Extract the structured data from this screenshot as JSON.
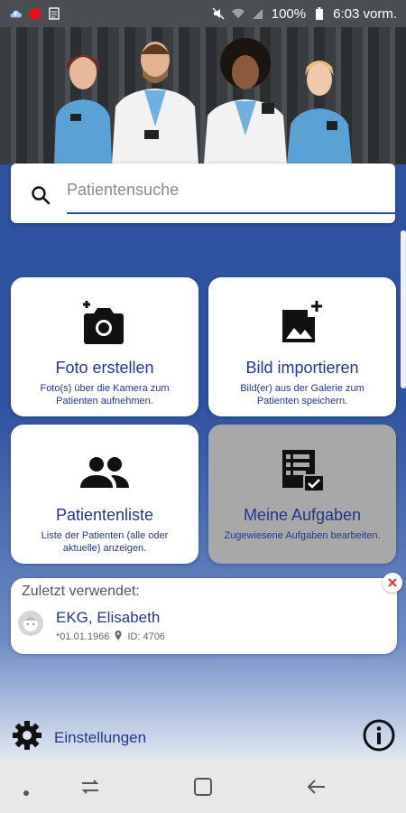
{
  "status_bar": {
    "battery": "100%",
    "time": "6:03 vorm.",
    "icons": [
      "cloud-icon",
      "record-dot-icon",
      "document-icon",
      "mute-icon",
      "wifi-icon",
      "signal-icon",
      "battery-icon"
    ]
  },
  "hero": {
    "image": "doctors-group-photo"
  },
  "search": {
    "placeholder": "Patientensuche",
    "value": ""
  },
  "tiles": [
    {
      "title": "Foto erstellen",
      "desc": "Foto(s) über die Kamera zum Patienten aufnehmen.",
      "icon": "add-camera-icon",
      "enabled": true
    },
    {
      "title": "Bild importieren",
      "desc": "Bild(er) aus der Galerie zum Patienten speichern.",
      "icon": "add-image-icon",
      "enabled": true
    },
    {
      "title": "Patientenliste",
      "desc": "Liste der Patienten (alle oder aktuelle) anzeigen.",
      "icon": "people-icon",
      "enabled": true
    },
    {
      "title": "Meine Aufgaben",
      "desc": "Zugewiesene Aufgaben bearbeiten.",
      "icon": "task-list-icon",
      "enabled": false
    }
  ],
  "recent": {
    "label": "Zuletzt verwendet:",
    "patient": {
      "name": "EKG, Elisabeth",
      "dob": "*01.01.1966",
      "id": "ID: 4706"
    }
  },
  "footer": {
    "settings_label": "Einstellungen"
  },
  "colors": {
    "primary": "#2f52a0",
    "text_blue": "#22368a",
    "disabled_tile": "#a8a8a8",
    "close_red": "#e53935"
  }
}
